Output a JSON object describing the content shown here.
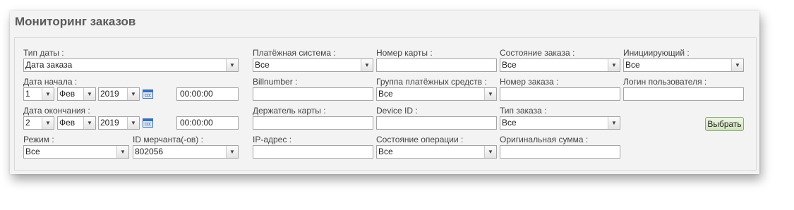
{
  "page": {
    "title": "Мониторинг заказов"
  },
  "filters": {
    "date_type": {
      "label": "Тип даты :",
      "value": "Дата заказа"
    },
    "start_date": {
      "label": "Дата начала :",
      "day": "1",
      "month": "Фев",
      "year": "2019",
      "time": "00:00:00"
    },
    "end_date": {
      "label": "Дата окончания :",
      "day": "2",
      "month": "Фев",
      "year": "2019",
      "time": "00:00:00"
    },
    "mode": {
      "label": "Режим :",
      "value": "Все"
    },
    "merchant_id": {
      "label": "ID мерчанта(-ов) :",
      "value": "802056"
    },
    "payment_system": {
      "label": "Платёжная система :",
      "value": "Все"
    },
    "billnumber": {
      "label": "Billnumber :",
      "value": ""
    },
    "card_holder": {
      "label": "Держатель карты :",
      "value": ""
    },
    "ip_address": {
      "label": "IP-адрес :",
      "value": ""
    },
    "card_number": {
      "label": "Номер карты :",
      "value": ""
    },
    "payment_group": {
      "label": "Группа платёжных средств :",
      "value": "Все"
    },
    "device_id": {
      "label": "Device ID :",
      "value": ""
    },
    "operation_state": {
      "label": "Состояние операции :",
      "value": "Все"
    },
    "order_state": {
      "label": "Состояние заказа :",
      "value": "Все"
    },
    "order_number": {
      "label": "Номер заказа :",
      "value": ""
    },
    "order_type": {
      "label": "Тип заказа :",
      "value": "Все"
    },
    "original_amount": {
      "label": "Оригинальная сумма :",
      "value": ""
    },
    "initiator": {
      "label": "Инициирующий :",
      "value": "Все"
    },
    "user_login": {
      "label": "Логин пользователя :",
      "value": ""
    },
    "submit_label": "Выбрать"
  },
  "icons": {
    "dropdown": "chevron-down-icon",
    "calendar": "calendar-icon"
  }
}
